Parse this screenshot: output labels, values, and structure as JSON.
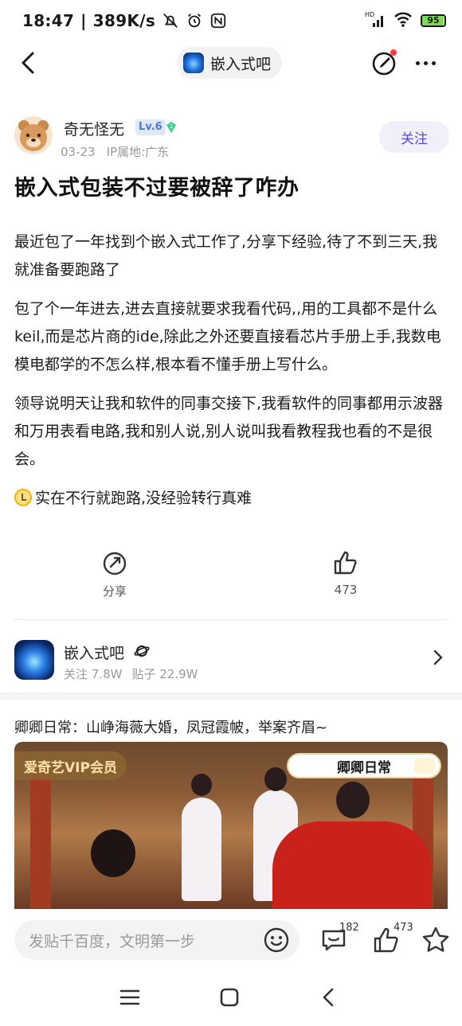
{
  "status_bar": {
    "time": "18:47",
    "net_speed": "389K/s",
    "battery": "95",
    "battery_level": 0.95,
    "icons": [
      "mute-bell-icon",
      "alarm-icon",
      "nfc-icon",
      "hd-signal-icon",
      "wifi-icon",
      "battery-icon"
    ]
  },
  "nav": {
    "forum_name": "嵌入式吧",
    "icons": [
      "back-icon",
      "edit-icon",
      "more-icon"
    ]
  },
  "author": {
    "name": "奇无怪无",
    "level": "Lv.6",
    "gem_level": "1",
    "date": "03-23",
    "ip": "IP属地:广东",
    "follow_label": "关注"
  },
  "post": {
    "title": "嵌入式包装不过要被辞了咋办",
    "paragraphs": [
      "最近包了一年找到个嵌入式工作了,分享下经验,待了不到三天,我就准备要跑路了",
      "包了个一年进去,进去直接就要求我看代码,,用的工具都不是什么keil,而是芯片商的ide,除此之外还要直接看芯片手册上手,我数电模电都学的不怎么样,根本看不懂手册上写什么。",
      "领导说明天让我和软件的同事交接下,我看软件的同事都用示波器和万用表看电路,我和别人说,别人说叫我看教程我也看的不是很会。",
      "实在不行就跑路,没经验转行真难"
    ]
  },
  "actions": {
    "share_label": "分享",
    "like_count": "473"
  },
  "forum_card": {
    "name": "嵌入式吧",
    "followers": "关注 7.8W",
    "posts": "贴子 22.9W"
  },
  "ad": {
    "title": "卿卿日常：山峥海薇大婚，凤冠霞帔，举案齐眉~",
    "vip_label": "爱奇艺VIP会员",
    "show_label": "卿卿日常"
  },
  "bottom_bar": {
    "input_placeholder": "发贴千百度，文明第一步",
    "comment_count": "182",
    "like_count": "473"
  },
  "colors": {
    "accent": "#5b4bd6",
    "follow_bg": "#f1effa",
    "battery_fill": "#7ed957",
    "notification_dot": "#ff3b3b"
  }
}
